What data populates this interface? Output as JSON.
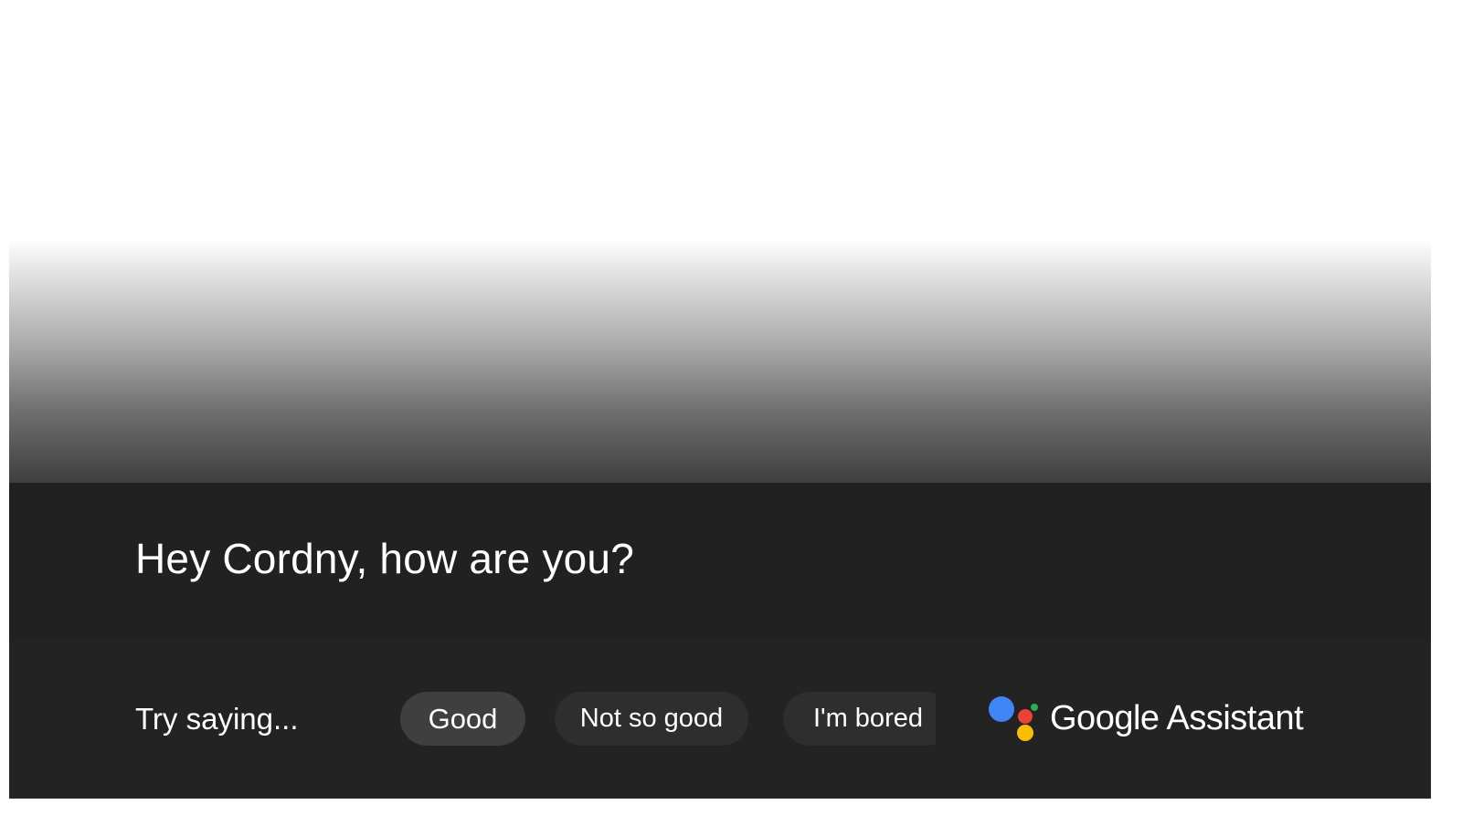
{
  "assistant": {
    "message": "Hey Cordny, how are you?"
  },
  "suggestions": {
    "label": "Try saying...",
    "chips": [
      "Good",
      "Not so good",
      "I'm bored"
    ],
    "selected_index": 0
  },
  "branding": {
    "name": "Google Assistant",
    "logo_icon": "google-assistant-dots-icon",
    "logo_colors": [
      "#4285F4",
      "#EA4335",
      "#FBBC05",
      "#34A853"
    ]
  },
  "colors": {
    "response_background": "#212121",
    "suggestion_background": "#232323",
    "chip_background": "#2e2e2e",
    "chip_selected_background": "#3f3f3f",
    "text": "#ffffff"
  }
}
